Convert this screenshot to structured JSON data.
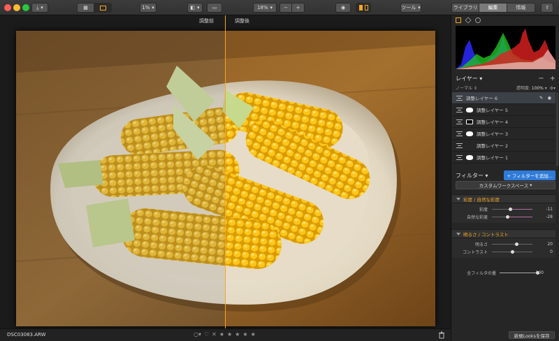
{
  "toolbar": {
    "zoom_small": "1%",
    "zoom": "18%",
    "minus": "−",
    "plus": "+",
    "tools": "ツール",
    "tabs": [
      "ライブラリ",
      "編集",
      "情報"
    ],
    "active_tab": "編集"
  },
  "canvas": {
    "before_label": "調整前",
    "after_label": "調整後",
    "accent": "#f5a623"
  },
  "bottom": {
    "filename": "DSC03083.ARW",
    "stars": [
      "★",
      "★",
      "★",
      "★",
      "★"
    ],
    "reject": "✕",
    "heart": "♡"
  },
  "panel": {
    "layers_title": "レイヤー",
    "blend_mode": "ノーマル",
    "opacity_label": "透明度:",
    "opacity_value": "100%",
    "layers": [
      {
        "name": "調整レイヤー 6",
        "mask": "none",
        "selected": true
      },
      {
        "name": "調整レイヤー 5",
        "mask": "oval",
        "selected": false
      },
      {
        "name": "調整レイヤー 4",
        "mask": "box",
        "selected": false
      },
      {
        "name": "調整レイヤー 3",
        "mask": "oval",
        "selected": false
      },
      {
        "name": "調整レイヤー 2",
        "mask": "none",
        "selected": false
      },
      {
        "name": "調整レイヤー 1",
        "mask": "oval",
        "selected": false
      }
    ],
    "filters_title": "フィルター",
    "add_filter": "+ フィルターを追加...",
    "workspace": "カスタムワークスペース",
    "sections": [
      {
        "title": "彩度 / 自然な彩度",
        "rows": [
          {
            "label": "彩度",
            "value": "-11",
            "pos": 0.45
          },
          {
            "label": "自然な彩度",
            "value": "-28",
            "pos": 0.38
          }
        ]
      },
      {
        "title": "明るさ / コントラスト",
        "rows": [
          {
            "label": "明るさ",
            "value": "20",
            "pos": 0.6
          },
          {
            "label": "コントラスト",
            "value": "0",
            "pos": 0.5
          }
        ]
      }
    ],
    "overall_label": "全フィルタの量",
    "overall_value": "100",
    "save_looks": "新規Looksを保存"
  }
}
